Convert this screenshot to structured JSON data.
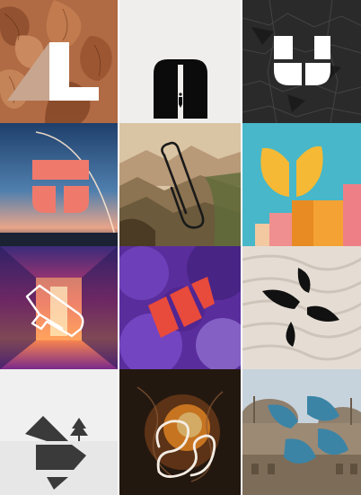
{
  "gallery": {
    "tiles": [
      {
        "id": "leaves-triangle",
        "background": "leaf-pattern",
        "logo": "triangle-block-mark",
        "colors": {
          "bg": "#b06a44",
          "accent": "#c7a58f",
          "mark": "#ffffff"
        }
      },
      {
        "id": "white-arch",
        "background": "plain-white",
        "logo": "black-arch-door-mark",
        "colors": {
          "bg": "#efeeed",
          "mark": "#0b0b0b"
        }
      },
      {
        "id": "dark-rock",
        "background": "dark-texture",
        "logo": "white-u-block-mark",
        "colors": {
          "bg": "#2a2a2a",
          "mark": "#ffffff"
        }
      },
      {
        "id": "launch-sky",
        "background": "dusk-sky",
        "logo": "coral-bars-mark",
        "colors": {
          "bg": "#2b4e7a",
          "mark": "#ef7a6c"
        }
      },
      {
        "id": "painting-cliffs",
        "background": "landscape-painting",
        "logo": "line-paperclip-mark",
        "colors": {
          "bg": "#c8b08f",
          "mark": "#1a1a1a"
        }
      },
      {
        "id": "yellow-tulip",
        "background": "sky-blocks",
        "logo": "yellow-tulip-mark",
        "colors": {
          "bg": "#47b7c9",
          "mark": "#f5b935",
          "block": "#f3a233",
          "accent": "#ef7f86"
        }
      },
      {
        "id": "neon-corridor",
        "background": "neon-hall",
        "logo": "outline-ribbon-mark",
        "colors": {
          "bg": "#cc3c75",
          "mark": "#ffffff",
          "accent": "#ff9b4e"
        }
      },
      {
        "id": "purple-smoke",
        "background": "smoke",
        "logo": "red-slats-mark",
        "colors": {
          "bg": "#5a2d9c",
          "mark": "#e84a3b"
        }
      },
      {
        "id": "sand-ripples",
        "background": "sand-waves",
        "logo": "black-leaf-cross-mark",
        "colors": {
          "bg": "#e5ddd4",
          "mark": "#111111"
        }
      },
      {
        "id": "snow-tree",
        "background": "snow-field",
        "logo": "hexagon-split-mark",
        "colors": {
          "bg": "#f0f0f0",
          "mark": "#3a3a3a"
        }
      },
      {
        "id": "fire-swirl",
        "background": "fire-smoke",
        "logo": "white-scribble-mark",
        "colors": {
          "bg": "#23180f",
          "mark": "#f4ede4",
          "accent": "#f08b25"
        }
      },
      {
        "id": "mosque-dome",
        "background": "architecture",
        "logo": "blue-leaf-cross-mark",
        "colors": {
          "bg": "#bfcad3",
          "mark": "#3b84a6"
        }
      }
    ]
  }
}
